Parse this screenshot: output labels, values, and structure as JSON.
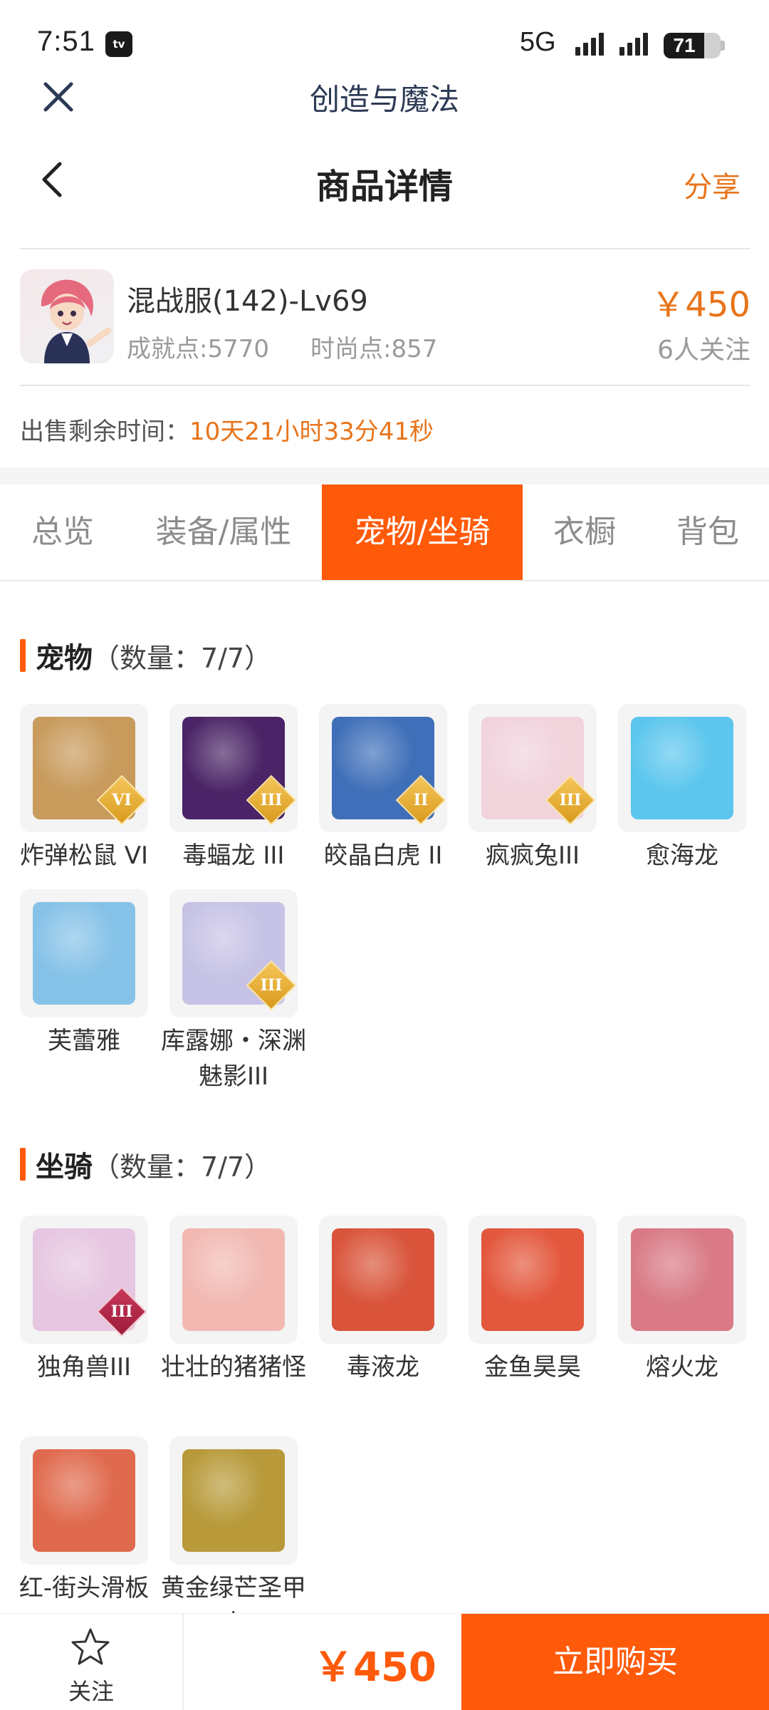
{
  "status_bar": {
    "time": "7:51",
    "tv_badge": "tv",
    "network": "5G",
    "battery": "71",
    "battery_level": 0.71
  },
  "app_bar": {
    "title": "创造与魔法",
    "close_icon": "close-icon"
  },
  "nav": {
    "title": "商品详情",
    "share": "分享",
    "back_icon": "chevron-left-icon"
  },
  "account": {
    "name": "混战服(142)-Lv69",
    "achievement": "成就点:5770",
    "fashion": "时尚点:857",
    "price": "￥450",
    "followers": "6人关注"
  },
  "sale_time": {
    "label": "出售剩余时间：",
    "value": "10天21小时33分41秒"
  },
  "tabs": [
    {
      "label": "总览",
      "active": false
    },
    {
      "label": "装备/属性",
      "active": false
    },
    {
      "label": "宠物/坐骑",
      "active": true
    },
    {
      "label": "衣橱",
      "active": false
    },
    {
      "label": "背包",
      "active": false
    }
  ],
  "pets": {
    "title": "宠物",
    "count": "（数量：7/7）",
    "items": [
      {
        "name": "炸弹松鼠 VI",
        "grade": "VI",
        "color": "#c89a5c"
      },
      {
        "name": "毒蝠龙 III",
        "grade": "III",
        "color": "#4a2466"
      },
      {
        "name": "皎晶白虎 II",
        "grade": "II",
        "color": "#3f6fb8"
      },
      {
        "name": "疯疯兔III",
        "grade": "III",
        "color": "#f1d3dc"
      },
      {
        "name": "愈海龙",
        "grade": "",
        "color": "#5cc6ee"
      },
      {
        "name": "芙蕾雅",
        "grade": "",
        "color": "#86c2e8"
      },
      {
        "name": "库露娜・深渊魅影III",
        "grade": "III",
        "color": "#c7c3e6"
      }
    ]
  },
  "mounts": {
    "title": "坐骑",
    "count": "（数量：7/7）",
    "items": [
      {
        "name": "独角兽III",
        "grade": "III",
        "color": "#e6c6e0"
      },
      {
        "name": "壮壮的猪猪怪",
        "grade": "",
        "color": "#f2b9b3"
      },
      {
        "name": "毒液龙",
        "grade": "",
        "color": "#d9543a"
      },
      {
        "name": "金鱼昊昊",
        "grade": "",
        "color": "#e3573c"
      },
      {
        "name": "熔火龙",
        "grade": "",
        "color": "#d97a86"
      },
      {
        "name": "红-街头滑板",
        "grade": "",
        "color": "#e06a4e"
      },
      {
        "name": "黄金绿芒圣甲虫",
        "grade": "",
        "color": "#b89a3a"
      }
    ]
  },
  "bottom_bar": {
    "follow": "关注",
    "price": "￥450",
    "buy": "立即购买"
  },
  "colors": {
    "accent": "#ff5a0a",
    "price": "#e8741a",
    "muted": "#9a9a9a"
  }
}
